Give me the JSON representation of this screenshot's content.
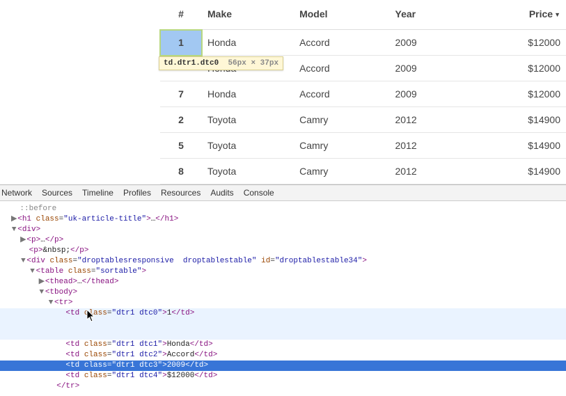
{
  "table": {
    "headers": {
      "idx": "#",
      "make": "Make",
      "model": "Model",
      "year": "Year",
      "price": "Price"
    },
    "rows": [
      {
        "idx": "1",
        "make": "Honda",
        "model": "Accord",
        "year": "2009",
        "price": "$12000"
      },
      {
        "idx": "",
        "make": "Honda",
        "model": "Accord",
        "year": "2009",
        "price": "$12000"
      },
      {
        "idx": "7",
        "make": "Honda",
        "model": "Accord",
        "year": "2009",
        "price": "$12000"
      },
      {
        "idx": "2",
        "make": "Toyota",
        "model": "Camry",
        "year": "2012",
        "price": "$14900"
      },
      {
        "idx": "5",
        "make": "Toyota",
        "model": "Camry",
        "year": "2012",
        "price": "$14900"
      },
      {
        "idx": "8",
        "make": "Toyota",
        "model": "Camry",
        "year": "2012",
        "price": "$14900"
      }
    ]
  },
  "inspect_tooltip": {
    "selector": "td.dtr1.dtc0",
    "dims": "56px × 37px"
  },
  "devtools": {
    "tabs": [
      "Network",
      "Sources",
      "Timeline",
      "Profiles",
      "Resources",
      "Audits",
      "Console"
    ],
    "dom": {
      "pseudo_before": "::before",
      "h1_open": "<h1 class=\"uk-article-title\">",
      "ellipsis": "…",
      "h1_close": "</h1>",
      "div_open": "<div>",
      "p_open": "<p>",
      "p_close": "</p>",
      "nbsp": "&nbsp;",
      "wrap_div": "<div class=\"droptablesresponsive  droptablestable\" id=\"droptablestable34\">",
      "table_open": "<table class=\"sortable\">",
      "thead": "<thead>…</thead>",
      "tbody_open": "<tbody>",
      "tr_open": "<tr>",
      "td0": "<td class=\"dtr1 dtc0\">1</td>",
      "td1": "<td class=\"dtr1 dtc1\">Honda</td>",
      "td2": "<td class=\"dtr1 dtc2\">Accord</td>",
      "td3": "<td class=\"dtr1 dtc3\">2009</td>",
      "td4": "<td class=\"dtr1 dtc4\">$12000</td>",
      "tr_close": "</tr>"
    }
  }
}
